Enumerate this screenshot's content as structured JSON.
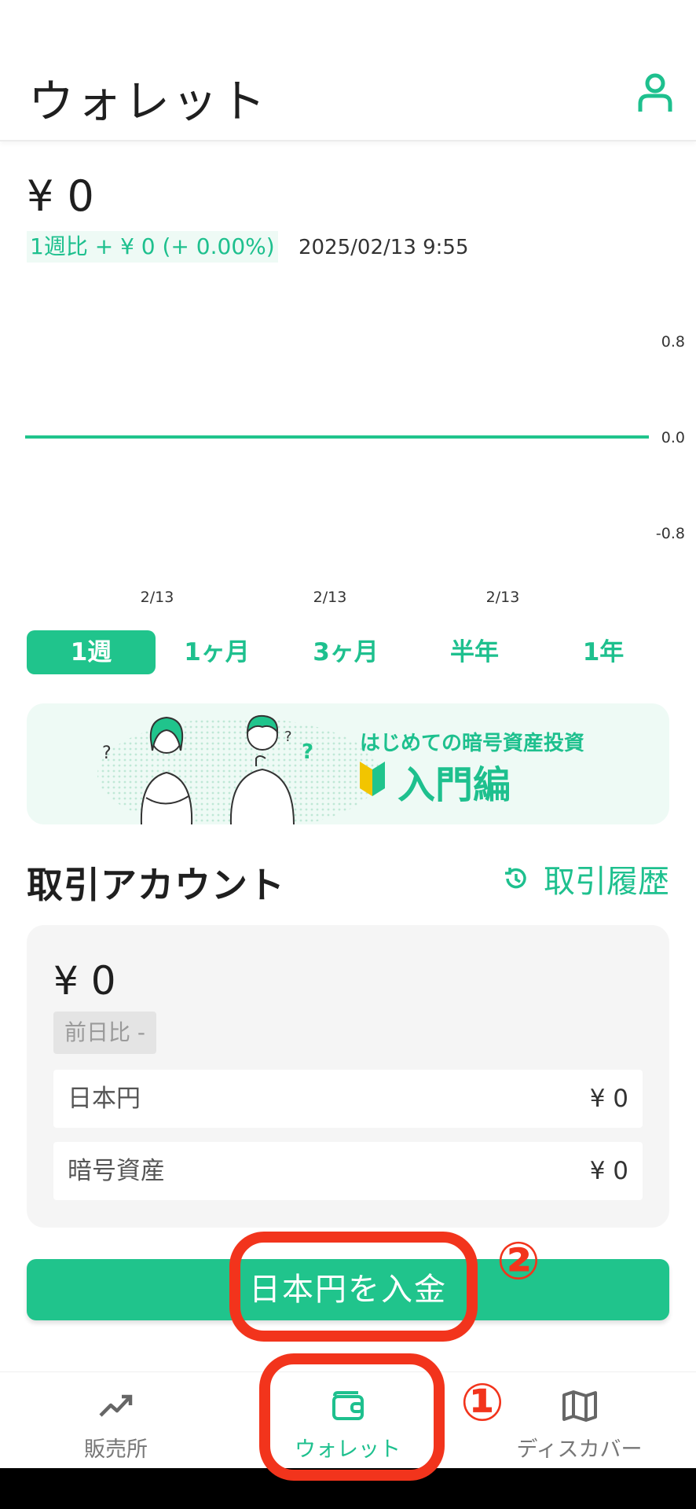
{
  "header": {
    "title": "ウォレット",
    "profile_icon": "user-icon"
  },
  "summary": {
    "total": "¥ 0",
    "change": "1週比 + ¥ 0 (+ 0.00%)",
    "timestamp": "2025/02/13 9:55"
  },
  "chart_data": {
    "type": "line",
    "x": [
      "2/13",
      "2/13",
      "2/13"
    ],
    "series": [
      {
        "values": [
          0,
          0,
          0
        ]
      }
    ],
    "y_ticks": [
      "0.8",
      "0.0",
      "-0.8"
    ],
    "ylim": [
      -0.8,
      0.8
    ],
    "line_color": "#20c48c",
    "grid": false
  },
  "periods": [
    {
      "label": "1週",
      "active": true
    },
    {
      "label": "1ヶ月",
      "active": false
    },
    {
      "label": "3ヶ月",
      "active": false
    },
    {
      "label": "半年",
      "active": false
    },
    {
      "label": "1年",
      "active": false
    }
  ],
  "banner": {
    "subtitle": "はじめての暗号資産投資",
    "title": "入門編",
    "icon": "beginner-leaf-icon"
  },
  "account": {
    "title": "取引アカウント",
    "history_label": "取引履歴",
    "history_icon": "history-icon",
    "amount": "¥ 0",
    "day_change": "前日比 -",
    "rows": [
      {
        "label": "日本円",
        "value": "¥ 0"
      },
      {
        "label": "暗号資産",
        "value": "¥ 0"
      }
    ]
  },
  "deposit_button": "日本円を入金",
  "tabs": [
    {
      "label": "販売所",
      "icon": "trend-up-icon",
      "active": false
    },
    {
      "label": "ウォレット",
      "icon": "wallet-icon",
      "active": true
    },
    {
      "label": "ディスカバー",
      "icon": "map-icon",
      "active": false
    }
  ],
  "annotations": {
    "step1": "①",
    "step2": "②"
  },
  "colors": {
    "accent": "#20c48c",
    "annotation": "#f2341c"
  }
}
